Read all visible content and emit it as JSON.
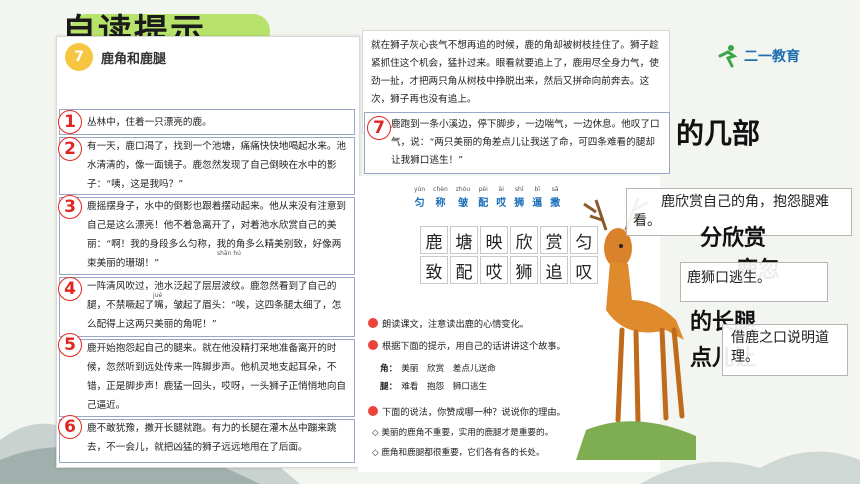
{
  "bg": {
    "title": "自读提示",
    "frag_parts": "的几部",
    "frag_appreciate": "分欣赏",
    "frag_deer": "鹿忽",
    "frag_long_legs": "的长腿",
    "frag_remind": "点儿让"
  },
  "logo": {
    "text": "二一教育"
  },
  "story": {
    "number": "7",
    "title": "鹿角和鹿腿",
    "paragraphs": [
      {
        "num": "1",
        "text": "丛林中，住着一只漂亮的鹿。"
      },
      {
        "num": "2",
        "text": "有一天，鹿口渴了，找到一个池塘，痛痛快快地喝起水来。池水清清的，像一面镜子。鹿忽然发现了自己倒映在水中的影子：“咦，这是我吗？”"
      },
      {
        "num": "3",
        "text": "鹿摇摆身子，水中的倒影也跟着摆动起来。他从来没有注意到自己是这么漂亮！他不着急离开了，对着池水欣赏自己的美丽：“啊！我的身段多么匀称，我的角多么精美别致，好像两束美丽的珊瑚！”"
      },
      {
        "num": "4",
        "text": "一阵清风吹过，池水泛起了层层波纹。鹿忽然看到了自己的腿，不禁噘起了嘴，皱起了眉头：“唉，这四条腿太细了，怎么配得上这两只美丽的角呢！”"
      },
      {
        "num": "5",
        "text": "鹿开始抱怨起自己的腿来。就在他没精打采地准备离开的时候，忽然听到远处传来一阵脚步声。他机灵地支起耳朵，不错，正是脚步声！鹿猛一回头，哎呀，一头狮子正悄悄地向自己逼近。"
      },
      {
        "num": "6",
        "text": "鹿不敢犹豫，撒开长腿就跑。有力的长腿在灌木丛中蹦来跳去，不一会儿，就把凶猛的狮子远远地甩在了后面。"
      }
    ],
    "pinyin_marks": {
      "shanhu": "shān hú",
      "jue": "jué"
    }
  },
  "top_page": {
    "paragraph": "就在狮子灰心丧气不想再追的时候，鹿的角却被树枝挂住了。狮子趁紧抓住这个机会，猛扑过来。眼看就要追上了，鹿用尽全身力气，使劲一扯，才把两只角从树枝中挣脱出来，然后又拼命向前奔去。这次，狮子再也没有追上。",
    "para7_num": "7",
    "para7": "鹿跑到一条小溪边，停下脚步，一边喘气，一边休息。他叹了口气，说：“两只美丽的角差点儿让我送了命，可四条难看的腿却让我狮口逃生！”"
  },
  "book": {
    "pinyin_chars": [
      {
        "py": "yún",
        "hz": "匀"
      },
      {
        "py": "chèn",
        "hz": "称"
      },
      {
        "py": "zhòu",
        "hz": "皱"
      },
      {
        "py": "pèi",
        "hz": "配"
      },
      {
        "py": "āi",
        "hz": "哎"
      },
      {
        "py": "shī",
        "hz": "狮"
      },
      {
        "py": "bī",
        "hz": "逼"
      },
      {
        "py": "sā",
        "hz": "撒"
      }
    ],
    "grid_chars": [
      "鹿",
      "塘",
      "映",
      "欣",
      "赏",
      "匀",
      "致",
      "配",
      "哎",
      "狮",
      "追",
      "叹"
    ],
    "task1": "朗读课文，注意读出鹿的心情变化。",
    "task2": "根据下面的提示，用自己的话讲讲这个故事。",
    "task2_sub1_label": "角：",
    "task2_sub1": "美丽　欣赏　差点儿送命",
    "task2_sub2_label": "腿：",
    "task2_sub2": "难看　抱怨　狮口逃生",
    "task3": "下面的说法，你赞成哪一种？说说你的理由。",
    "opt1": "◇ 美丽的鹿角不重要，实用的鹿腿才是重要的。",
    "opt2": "◇ 鹿角和鹿腿都很重要，它们各有各的长处。"
  },
  "overlays": {
    "ov1": "鹿欣赏自己的角，抱怨腿难看。",
    "ov2": "鹿狮口逃生。",
    "ov3": "借鹿之口说明道理。"
  }
}
